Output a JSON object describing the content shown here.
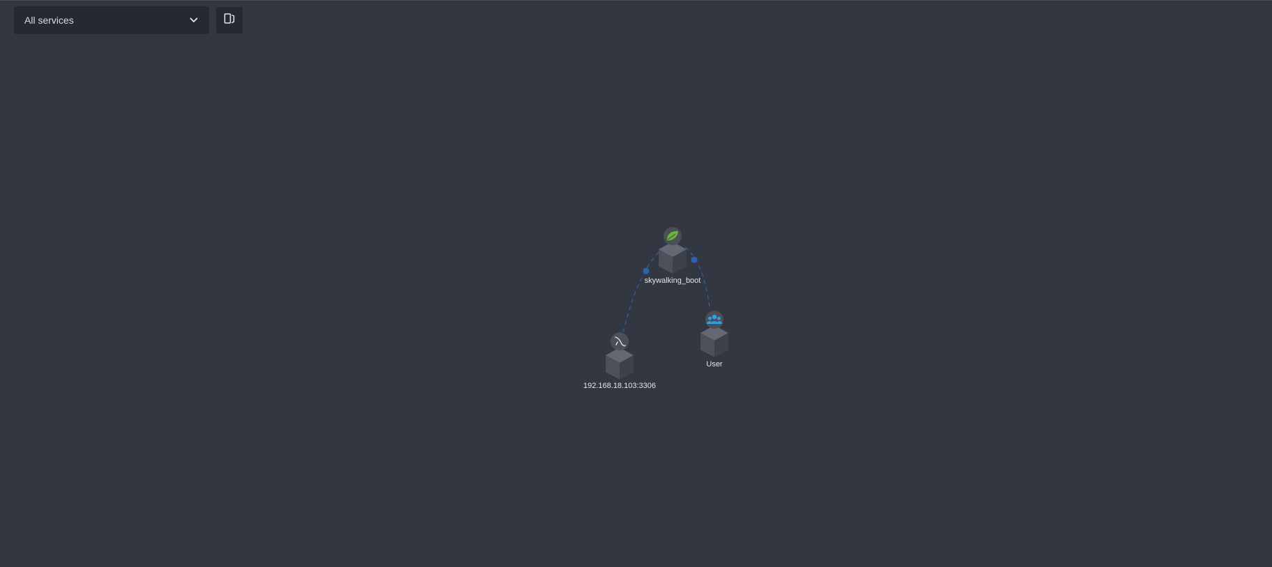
{
  "toolbar": {
    "service_selector": {
      "selected": "All services",
      "icon": "chevron-down-icon"
    },
    "toggle_button_icon": "panel-toggle-icon"
  },
  "topology": {
    "nodes": [
      {
        "id": "skywalking_boot",
        "label": "skywalking_boot",
        "icon": "spring-leaf-icon",
        "icon_color": "#6db33f"
      },
      {
        "id": "mysql",
        "label": "192.168.18.103:3306",
        "icon": "mysql-dolphin-icon",
        "icon_color": "#e6e6e6"
      },
      {
        "id": "user",
        "label": "User",
        "icon": "users-icon",
        "icon_color": "#2aa3e8"
      }
    ],
    "edges": [
      {
        "from": "skywalking_boot",
        "to": "mysql"
      },
      {
        "from": "user",
        "to": "skywalking_boot"
      }
    ],
    "edge_color": "#2d5c99"
  }
}
